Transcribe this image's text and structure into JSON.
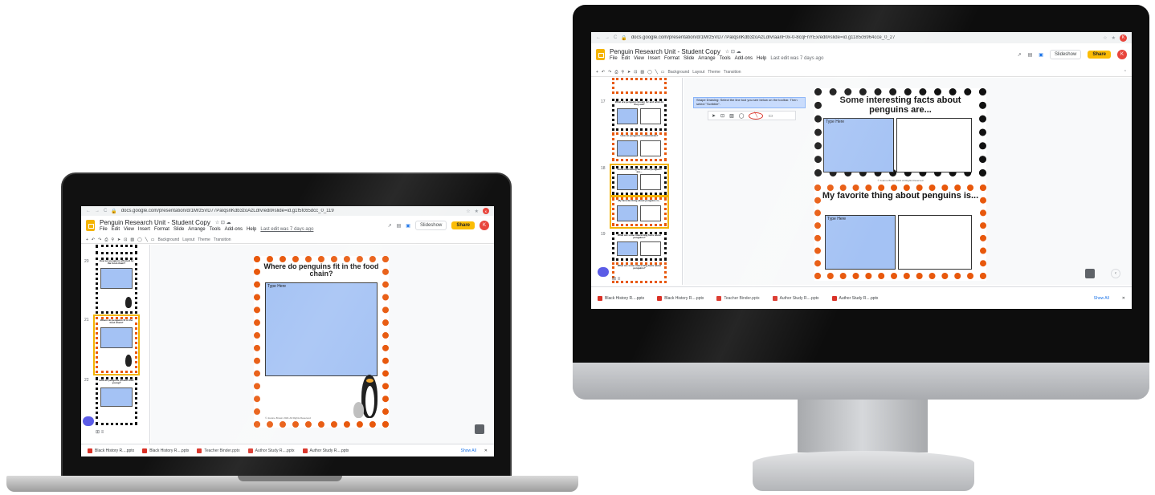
{
  "app": {
    "doc_title": "Penguin Research Unit - Student Copy",
    "title_icons": "☆ ⊡ ☁",
    "menu": [
      "File",
      "Edit",
      "View",
      "Insert",
      "Format",
      "Slide",
      "Arrange",
      "Tools",
      "Add-ons",
      "Help"
    ],
    "share_label": "Share",
    "slideshow_label": "Slideshow",
    "avatar_letter": "K",
    "brand_color": "#fbbc04"
  },
  "laptop": {
    "url": "docs.google.com/presentation/d/1Mrz5VD77PaIqsnKdb3zoAzLdrv/edit#slide=id.g1f5fc65dcc_0_119",
    "last_edit": "Last edit was 7 days ago",
    "toolbar": [
      "Background",
      "Layout",
      "Theme",
      "Transition"
    ],
    "slide_numbers": [
      "20",
      "21",
      "22"
    ],
    "thumb_titles": [
      "How are penguins affected by the food chain?",
      "Where do penguins fit in the food chain?",
      "How do penguins protect their young?"
    ],
    "slide": {
      "title": "Where do penguins fit in the food chain?",
      "type_here": "Type Here",
      "footer": "© Joanne Brown 2021 All Rights Reserved"
    },
    "downloads": [
      "Black History R....pptx",
      "Black History R....pptx",
      "Teacher Binder.pptx",
      "Author Study R....pptx",
      "Author Study R....pptx"
    ],
    "show_all": "Show All",
    "thumbnail_panel_icons": "⊞ ≡"
  },
  "monitor": {
    "url": "docs.google.com/presentation/d/1Mrz5VD77PaIqsnKdb3zoAzLdrvraanF0x-0-8cqFnYEx/edit#slide=id.g1185c6964cce_0_27",
    "last_edit": "Last edit was 7 days ago",
    "toolbar": [
      "Background",
      "Layout",
      "Theme",
      "Transition"
    ],
    "slide_numbers": [
      "17",
      "18",
      "19"
    ],
    "thumb_titles": [
      "What are penguins known for and what do they eat?",
      "How do penguins communicate?",
      "Some interesting facts about penguins are...",
      "My favorite thing about penguins is...",
      "What are some interesting facts about penguins?",
      "What are some interesting facts about penguins?"
    ],
    "tooltip": "Shape Drawing: Select the line tool you see below on the toolbar. Then select \"Scribble\".",
    "slide": {
      "title_top": "Some interesting facts about penguins are...",
      "title_bottom": "My favorite thing about penguins is...",
      "type_here_1": "Type Here",
      "type_here_2": "Type Here",
      "footer": "© Joanne Brown 2021 All Rights Reserved"
    },
    "downloads": [
      "Black History R....pptx",
      "Black History R....pptx",
      "Teacher Binder.pptx",
      "Author Study R....pptx",
      "Author Study R....pptx"
    ],
    "show_all": "Show All",
    "thumbnail_panel_icons": "⊞ ≡"
  }
}
